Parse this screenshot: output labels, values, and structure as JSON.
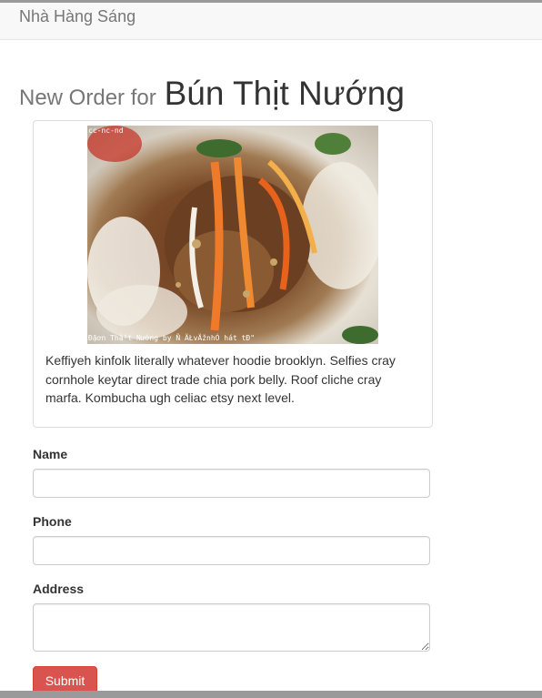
{
  "navbar": {
    "brand": "Nhà Hàng Sáng"
  },
  "heading": {
    "lead": "New Order for",
    "dish": "Bún Thịt Nướng"
  },
  "card": {
    "photo_license": "cc-nc-nd",
    "photo_caption": "Ðặơn Thấ¹t Nướng by Ñ ÄŁvÄžnhÓ hát tÐ\"",
    "description": "Keffiyeh kinfolk literally whatever hoodie brooklyn. Selfies cray cornhole keytar direct trade chia pork belly. Roof cliche cray marfa. Kombucha ugh celiac etsy next level."
  },
  "form": {
    "name_label": "Name",
    "name_value": "",
    "phone_label": "Phone",
    "phone_value": "",
    "address_label": "Address",
    "address_value": "",
    "submit_label": "Submit"
  },
  "colors": {
    "navbar_bg": "#f8f8f8",
    "submit_bg": "#d9534f",
    "border": "#dddddd"
  }
}
